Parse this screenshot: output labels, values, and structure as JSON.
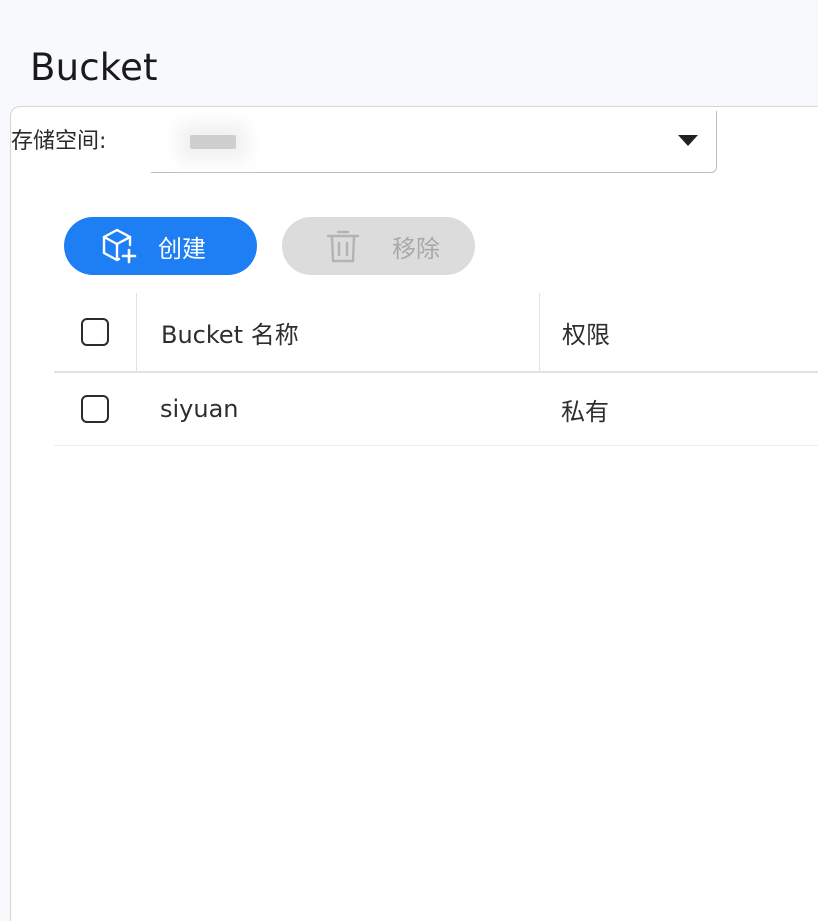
{
  "page": {
    "title": "Bucket"
  },
  "storage": {
    "label": "存储空间:",
    "selected_value": ""
  },
  "toolbar": {
    "create_label": "创建",
    "create_icon": "cube-plus-icon",
    "remove_label": "移除",
    "remove_icon": "trash-icon"
  },
  "table": {
    "columns": [
      "Bucket 名称",
      "权限"
    ],
    "rows": [
      {
        "name": "siyuan",
        "permission": "私有"
      }
    ]
  },
  "colors": {
    "primary": "#1e7ef3",
    "disabled_bg": "#dcdcdc",
    "disabled_text": "#a9a9a9"
  }
}
